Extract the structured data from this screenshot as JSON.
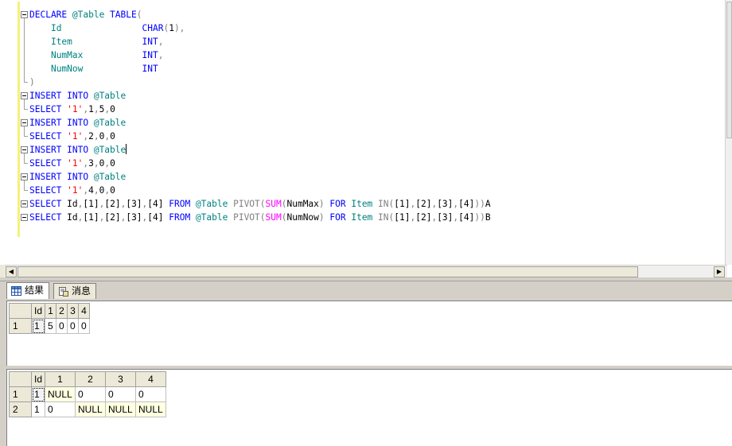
{
  "editor": {
    "lines": [
      [
        [
          "k",
          "DECLARE "
        ],
        [
          "v",
          "@Table "
        ],
        [
          "k",
          "TABLE"
        ],
        [
          "g",
          "("
        ]
      ],
      [
        [
          "t",
          "    "
        ],
        [
          "v",
          "Id"
        ],
        [
          "t",
          "               "
        ],
        [
          "k",
          "CHAR"
        ],
        [
          "g",
          "("
        ],
        [
          "t",
          "1"
        ],
        [
          "g",
          "),"
        ]
      ],
      [
        [
          "t",
          "    "
        ],
        [
          "v",
          "Item"
        ],
        [
          "t",
          "             "
        ],
        [
          "k",
          "INT"
        ],
        [
          "g",
          ","
        ]
      ],
      [
        [
          "t",
          "    "
        ],
        [
          "v",
          "NumMax"
        ],
        [
          "t",
          "           "
        ],
        [
          "k",
          "INT"
        ],
        [
          "g",
          ","
        ]
      ],
      [
        [
          "t",
          "    "
        ],
        [
          "v",
          "NumNow"
        ],
        [
          "t",
          "           "
        ],
        [
          "k",
          "INT"
        ]
      ],
      [
        [
          "g",
          ")"
        ]
      ],
      [
        [
          "k",
          "INSERT INTO "
        ],
        [
          "v",
          "@Table"
        ]
      ],
      [
        [
          "k",
          "SELECT "
        ],
        [
          "s",
          "'1'"
        ],
        [
          "g",
          ","
        ],
        [
          "t",
          "1"
        ],
        [
          "g",
          ","
        ],
        [
          "t",
          "5"
        ],
        [
          "g",
          ","
        ],
        [
          "t",
          "0"
        ]
      ],
      [
        [
          "k",
          "INSERT INTO "
        ],
        [
          "v",
          "@Table"
        ]
      ],
      [
        [
          "k",
          "SELECT "
        ],
        [
          "s",
          "'1'"
        ],
        [
          "g",
          ","
        ],
        [
          "t",
          "2"
        ],
        [
          "g",
          ","
        ],
        [
          "t",
          "0"
        ],
        [
          "g",
          ","
        ],
        [
          "t",
          "0"
        ]
      ],
      [
        [
          "k",
          "INSERT INTO "
        ],
        [
          "v",
          "@Table"
        ],
        [
          "caret",
          ""
        ]
      ],
      [
        [
          "k",
          "SELECT "
        ],
        [
          "s",
          "'1'"
        ],
        [
          "g",
          ","
        ],
        [
          "t",
          "3"
        ],
        [
          "g",
          ","
        ],
        [
          "t",
          "0"
        ],
        [
          "g",
          ","
        ],
        [
          "t",
          "0"
        ]
      ],
      [
        [
          "k",
          "INSERT INTO "
        ],
        [
          "v",
          "@Table"
        ]
      ],
      [
        [
          "k",
          "SELECT "
        ],
        [
          "s",
          "'1'"
        ],
        [
          "g",
          ","
        ],
        [
          "t",
          "4"
        ],
        [
          "g",
          ","
        ],
        [
          "t",
          "0"
        ],
        [
          "g",
          ","
        ],
        [
          "t",
          "0"
        ]
      ],
      [
        [
          "k",
          "SELECT "
        ],
        [
          "t",
          "Id"
        ],
        [
          "g",
          ","
        ],
        [
          "t",
          "[1]"
        ],
        [
          "g",
          ","
        ],
        [
          "t",
          "[2]"
        ],
        [
          "g",
          ","
        ],
        [
          "t",
          "[3]"
        ],
        [
          "g",
          ","
        ],
        [
          "t",
          "[4] "
        ],
        [
          "k",
          "FROM "
        ],
        [
          "v",
          "@Table "
        ],
        [
          "g",
          "PIVOT("
        ],
        [
          "f",
          "SUM"
        ],
        [
          "g",
          "("
        ],
        [
          "t",
          "NumMax"
        ],
        [
          "g",
          ") "
        ],
        [
          "k",
          "FOR "
        ],
        [
          "v",
          "Item "
        ],
        [
          "g",
          "IN("
        ],
        [
          "t",
          "[1]"
        ],
        [
          "g",
          ","
        ],
        [
          "t",
          "[2]"
        ],
        [
          "g",
          ","
        ],
        [
          "t",
          "[3]"
        ],
        [
          "g",
          ","
        ],
        [
          "t",
          "[4]"
        ],
        [
          "g",
          "))"
        ],
        [
          "t",
          "A"
        ]
      ],
      [
        [
          "k",
          "SELECT "
        ],
        [
          "t",
          "Id"
        ],
        [
          "g",
          ","
        ],
        [
          "t",
          "[1]"
        ],
        [
          "g",
          ","
        ],
        [
          "t",
          "[2]"
        ],
        [
          "g",
          ","
        ],
        [
          "t",
          "[3]"
        ],
        [
          "g",
          ","
        ],
        [
          "t",
          "[4] "
        ],
        [
          "k",
          "FROM "
        ],
        [
          "v",
          "@Table "
        ],
        [
          "g",
          "PIVOT("
        ],
        [
          "f",
          "SUM"
        ],
        [
          "g",
          "("
        ],
        [
          "t",
          "NumNow"
        ],
        [
          "g",
          ") "
        ],
        [
          "k",
          "FOR "
        ],
        [
          "v",
          "Item "
        ],
        [
          "g",
          "IN("
        ],
        [
          "t",
          "[1]"
        ],
        [
          "g",
          ","
        ],
        [
          "t",
          "[2]"
        ],
        [
          "g",
          ","
        ],
        [
          "t",
          "[3]"
        ],
        [
          "g",
          ","
        ],
        [
          "t",
          "[4]"
        ],
        [
          "g",
          "))"
        ],
        [
          "t",
          "B"
        ]
      ]
    ]
  },
  "tabs": [
    {
      "label": "结果",
      "icon": "grid-icon",
      "active": true
    },
    {
      "label": "消息",
      "icon": "messages-icon",
      "active": false
    }
  ],
  "result1": {
    "columns": [
      "Id",
      "1",
      "2",
      "3",
      "4"
    ],
    "rows": [
      {
        "num": "1",
        "cells": [
          "1",
          "5",
          "0",
          "0",
          "0"
        ]
      }
    ]
  },
  "result2": {
    "columns": [
      "Id",
      "1",
      "2",
      "3",
      "4"
    ],
    "rows": [
      {
        "num": "1",
        "cells": [
          "1",
          "NULL",
          "0",
          "0",
          "0"
        ]
      },
      {
        "num": "2",
        "cells": [
          "1",
          "0",
          "NULL",
          "NULL",
          "NULL"
        ]
      }
    ]
  },
  "colors": {
    "keyword": "#0000ff",
    "variable": "#008080",
    "string": "#ff0000",
    "function": "#ff00ff",
    "operator": "#808080",
    "null_cell": "#ffffe1"
  }
}
